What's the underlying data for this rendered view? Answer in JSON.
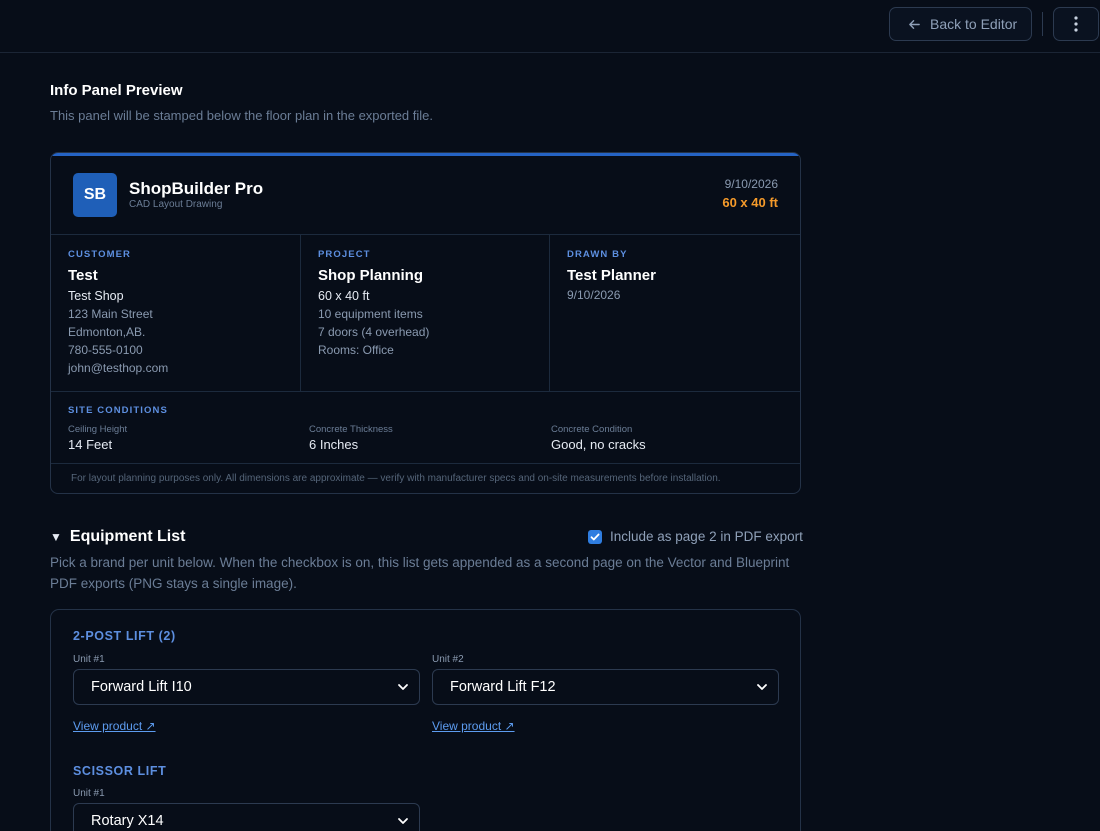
{
  "topbar": {
    "back_label": "Back to Editor",
    "back_icon": "arrow-left-icon",
    "more_icon": "more-vertical-icon"
  },
  "preview": {
    "title": "Info Panel Preview",
    "subtitle": "This panel will be stamped below the floor plan in the exported file."
  },
  "panel": {
    "logo_text": "SB",
    "brand_name": "ShopBuilder Pro",
    "brand_sub": "CAD Layout Drawing",
    "date": "9/10/2026",
    "size": "60 x 40 ft",
    "customer": {
      "label": "CUSTOMER",
      "name": "Test",
      "company": "Test Shop",
      "street": "123 Main Street",
      "city": "Edmonton,AB.",
      "phone": "780-555-0100",
      "email": "john@testhop.com"
    },
    "project": {
      "label": "PROJECT",
      "name": "Shop Planning",
      "dims": "60 x 40 ft",
      "equipment": "10 equipment items",
      "doors": "7 doors (4 overhead)",
      "rooms": "Rooms: Office"
    },
    "drawn_by": {
      "label": "DRAWN BY",
      "name": "Test Planner",
      "date": "9/10/2026"
    },
    "site": {
      "label": "SITE CONDITIONS",
      "items": [
        {
          "key": "Ceiling Height",
          "value": "14 Feet"
        },
        {
          "key": "Concrete Thickness",
          "value": "6 Inches"
        },
        {
          "key": "Concrete Condition",
          "value": "Good, no cracks"
        }
      ]
    },
    "disclaimer": "For layout planning purposes only. All dimensions are approximate — verify with manufacturer specs and on-site measurements before installation."
  },
  "equipment": {
    "title": "Equipment List",
    "toggle_icon": "triangle-down-icon",
    "include_label": "Include as page 2 in PDF export",
    "include_checked": true,
    "description": "Pick a brand per unit below. When the checkbox is on, this list gets appended as a second page on the Vector and Blueprint PDF exports (PNG stays a single image).",
    "groups": [
      {
        "title": "2-POST LIFT (2)",
        "units": [
          {
            "label": "Unit #1",
            "value": "Forward Lift I10",
            "link": "View product ↗"
          },
          {
            "label": "Unit #2",
            "value": "Forward Lift F12",
            "link": "View product ↗"
          }
        ]
      },
      {
        "title": "SCISSOR LIFT",
        "units": [
          {
            "label": "Unit #1",
            "value": "Rotary X14"
          }
        ]
      }
    ]
  },
  "colors": {
    "background": "#070d18",
    "accent": "#2563c4",
    "size_highlight": "#f59a2a",
    "label_blue": "#5d8fe0"
  }
}
